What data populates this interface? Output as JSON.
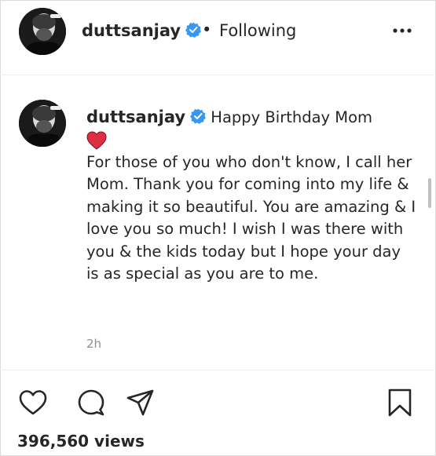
{
  "header": {
    "username": "duttsanjay",
    "separator": "•",
    "follow_status": "Following",
    "more_icon": "more-horizontal-icon"
  },
  "caption": {
    "username": "duttsanjay",
    "first_line": "Happy Birthday Mom",
    "emoji": "red-heart",
    "body": "For those of you who don't know, I call her Mom. Thank you for coming into my life & making it so beautiful. You are amazing & I love you so much! I wish I was there with you & the kids today but I hope your day is as special as you are to me.",
    "time": "2h"
  },
  "actions": {
    "icons": [
      "heart-icon",
      "comment-icon",
      "share-icon",
      "bookmark-icon"
    ],
    "views": "396,560 views"
  },
  "colors": {
    "verified": "#3897f0",
    "heart_emoji": "#dd2e44",
    "text": "#262626",
    "muted": "#8e8e8e",
    "divider": "#efefef"
  }
}
